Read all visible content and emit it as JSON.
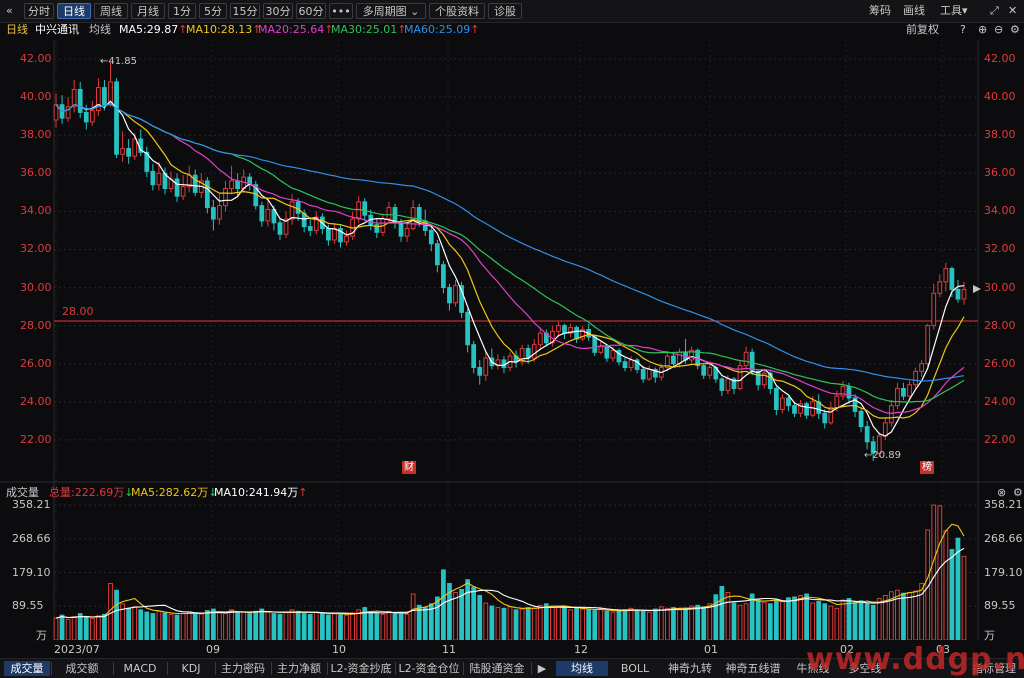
{
  "toolbar": {
    "back": "«",
    "buttons": [
      "分时",
      "日线",
      "周线",
      "月线",
      "1分",
      "5分",
      "15分",
      "30分",
      "60分",
      "•••",
      "多周期图 ⌄",
      "个股资料",
      "诊股"
    ],
    "active": "日线",
    "right": [
      "筹码",
      "画线",
      "工具▾"
    ]
  },
  "info": {
    "period": "日线",
    "stock": "中兴通讯",
    "ma_label": "均线",
    "ma5": "MA5:29.87",
    "ma10": "MA10:28.13",
    "ma20": "MA20:25.64",
    "ma30": "MA30:25.01",
    "ma60": "MA60:25.09",
    "adjust": "前复权"
  },
  "colors": {
    "up": "#e03a3a",
    "down": "#27c2c2",
    "ma5": "#ffffff",
    "ma10": "#f0c419",
    "ma20": "#e040c8",
    "ma30": "#2fc25b",
    "ma60": "#2f8fe8",
    "ref_line": "#e03a3a"
  },
  "price_axis": [
    "42.00",
    "40.00",
    "38.00",
    "36.00",
    "34.00",
    "32.00",
    "30.00",
    "28.00",
    "26.00",
    "24.00",
    "22.00"
  ],
  "ref_line_label": "28.00",
  "annotations": {
    "high": "←41.85",
    "low": "←20.89",
    "marker1": "财",
    "marker2": "榜"
  },
  "volume": {
    "title": "成交量",
    "total": "总量:222.69万",
    "ma5": "MA5:282.62万",
    "ma10": "MA10:241.94万",
    "axis": [
      "358.21",
      "268.66",
      "179.10",
      "89.55",
      "万"
    ]
  },
  "x_labels": [
    "2023/07",
    "09",
    "10",
    "11",
    "12",
    "01",
    "02",
    "03"
  ],
  "bottom_tabs_left": [
    "成交量",
    "成交额",
    "MACD",
    "KDJ",
    "主力密码",
    "主力净额",
    "L2-资金抄底",
    "L2-资金仓位",
    "陆股通资金"
  ],
  "bottom_tabs_right": [
    "均线",
    "BOLL",
    "神奇九转",
    "神奇五线谱",
    "牛熊线",
    "多空线"
  ],
  "bottom_right": "指标管理",
  "watermark": "www.ddgp.net",
  "chart_data": {
    "type": "candlestick",
    "symbol": "中兴通讯",
    "period": "日线",
    "ylim": [
      20,
      43
    ],
    "x_range": [
      "2023/07",
      "2024/03"
    ],
    "volume_ylim": [
      0,
      358.21
    ],
    "volume_unit": "万",
    "candles": [
      [
        38.8,
        39.6,
        40.2,
        38.4
      ],
      [
        39.6,
        38.9,
        40.1,
        38.6
      ],
      [
        38.9,
        39.5,
        40.0,
        38.7
      ],
      [
        39.5,
        40.4,
        40.9,
        39.2
      ],
      [
        40.4,
        39.2,
        40.8,
        38.9
      ],
      [
        39.2,
        38.7,
        39.6,
        38.3
      ],
      [
        38.7,
        39.3,
        39.8,
        38.5
      ],
      [
        39.3,
        40.5,
        41.0,
        39.0
      ],
      [
        40.5,
        39.6,
        40.9,
        39.3
      ],
      [
        39.6,
        40.8,
        41.85,
        39.5
      ],
      [
        40.8,
        37.0,
        41.0,
        36.8
      ],
      [
        37.0,
        37.3,
        38.2,
        36.6
      ],
      [
        37.3,
        36.9,
        37.8,
        36.5
      ],
      [
        36.9,
        37.8,
        38.1,
        36.7
      ],
      [
        37.8,
        37.1,
        38.3,
        36.9
      ],
      [
        37.1,
        36.1,
        37.4,
        35.8
      ],
      [
        36.1,
        35.4,
        36.5,
        35.1
      ],
      [
        35.4,
        36.0,
        36.6,
        35.1
      ],
      [
        36.0,
        35.2,
        36.3,
        34.9
      ],
      [
        35.2,
        35.7,
        36.1,
        35.0
      ],
      [
        35.7,
        34.8,
        36.0,
        34.5
      ],
      [
        34.8,
        35.3,
        35.9,
        34.6
      ],
      [
        35.3,
        35.9,
        36.4,
        35.0
      ],
      [
        35.9,
        35.0,
        36.2,
        34.8
      ],
      [
        35.0,
        35.6,
        36.0,
        34.7
      ],
      [
        35.6,
        34.2,
        35.8,
        33.9
      ],
      [
        34.2,
        33.6,
        34.6,
        33.0
      ],
      [
        33.6,
        34.3,
        34.9,
        33.3
      ],
      [
        34.3,
        35.2,
        35.6,
        34.0
      ],
      [
        35.2,
        35.6,
        36.4,
        34.9
      ],
      [
        35.6,
        35.2,
        36.0,
        34.8
      ],
      [
        35.2,
        35.8,
        36.2,
        35.0
      ],
      [
        35.8,
        35.4,
        36.0,
        35.1
      ],
      [
        35.4,
        34.3,
        35.6,
        34.1
      ],
      [
        34.3,
        33.5,
        34.5,
        33.2
      ],
      [
        33.5,
        34.1,
        34.6,
        33.2
      ],
      [
        34.1,
        33.4,
        34.3,
        33.0
      ],
      [
        33.4,
        32.8,
        33.6,
        32.5
      ],
      [
        32.8,
        33.6,
        34.0,
        32.6
      ],
      [
        33.6,
        34.5,
        34.9,
        33.3
      ],
      [
        34.5,
        33.9,
        34.7,
        33.5
      ],
      [
        33.9,
        33.2,
        34.1,
        32.9
      ],
      [
        33.2,
        33.0,
        33.6,
        32.7
      ],
      [
        33.0,
        33.7,
        34.0,
        32.8
      ],
      [
        33.7,
        33.1,
        33.9,
        32.8
      ],
      [
        33.1,
        32.5,
        33.3,
        32.2
      ],
      [
        32.5,
        33.1,
        33.4,
        32.3
      ],
      [
        33.1,
        32.4,
        33.3,
        32.1
      ],
      [
        32.4,
        32.7,
        33.0,
        32.2
      ],
      [
        32.7,
        33.6,
        34.0,
        32.5
      ],
      [
        33.6,
        34.5,
        34.8,
        33.4
      ],
      [
        34.5,
        33.8,
        34.7,
        33.5
      ],
      [
        33.8,
        33.3,
        34.1,
        33.0
      ],
      [
        33.3,
        32.9,
        33.6,
        32.6
      ],
      [
        32.9,
        33.6,
        33.9,
        32.7
      ],
      [
        33.6,
        34.2,
        34.5,
        33.4
      ],
      [
        34.2,
        33.4,
        34.4,
        33.1
      ],
      [
        33.4,
        32.7,
        33.6,
        32.4
      ],
      [
        32.7,
        33.1,
        33.4,
        32.4
      ],
      [
        33.1,
        34.2,
        34.6,
        33.0
      ],
      [
        34.2,
        33.5,
        34.4,
        33.2
      ],
      [
        33.5,
        33.0,
        34.1,
        32.7
      ],
      [
        33.0,
        32.3,
        33.2,
        31.9
      ],
      [
        32.3,
        31.2,
        32.5,
        30.8
      ],
      [
        31.2,
        30.0,
        31.4,
        29.7
      ],
      [
        30.0,
        29.2,
        30.2,
        28.8
      ],
      [
        29.2,
        30.1,
        30.4,
        29.0
      ],
      [
        30.1,
        28.7,
        30.3,
        28.4
      ],
      [
        28.7,
        27.0,
        28.9,
        26.6
      ],
      [
        27.0,
        25.8,
        27.2,
        25.5
      ],
      [
        25.8,
        25.4,
        26.2,
        24.9
      ],
      [
        25.4,
        26.3,
        26.6,
        25.1
      ],
      [
        26.3,
        25.9,
        26.8,
        25.7
      ],
      [
        25.9,
        26.2,
        26.5,
        25.7
      ],
      [
        26.2,
        25.8,
        26.4,
        25.5
      ],
      [
        25.8,
        26.4,
        26.6,
        25.6
      ],
      [
        26.4,
        26.1,
        26.7,
        25.8
      ],
      [
        26.1,
        26.8,
        27.0,
        25.9
      ],
      [
        26.8,
        26.3,
        27.0,
        26.0
      ],
      [
        26.3,
        27.0,
        27.3,
        26.1
      ],
      [
        27.0,
        27.6,
        27.9,
        26.8
      ],
      [
        27.6,
        27.1,
        27.8,
        26.9
      ],
      [
        27.1,
        27.7,
        28.0,
        26.9
      ],
      [
        27.7,
        28.0,
        28.2,
        27.4
      ],
      [
        28.0,
        27.6,
        28.1,
        27.3
      ],
      [
        27.6,
        27.9,
        28.1,
        27.4
      ],
      [
        27.9,
        27.3,
        28.0,
        27.1
      ],
      [
        27.3,
        27.8,
        28.0,
        27.2
      ],
      [
        27.8,
        27.4,
        28.1,
        27.2
      ],
      [
        27.4,
        26.6,
        27.5,
        26.4
      ],
      [
        26.6,
        26.9,
        27.2,
        26.5
      ],
      [
        26.9,
        26.3,
        27.0,
        26.1
      ],
      [
        26.3,
        26.7,
        26.9,
        26.1
      ],
      [
        26.7,
        26.1,
        26.8,
        25.9
      ],
      [
        26.1,
        25.8,
        26.3,
        25.6
      ],
      [
        25.8,
        26.2,
        26.4,
        25.6
      ],
      [
        26.2,
        25.7,
        26.3,
        25.5
      ],
      [
        25.7,
        25.2,
        25.9,
        25.0
      ],
      [
        25.2,
        25.7,
        25.9,
        25.1
      ],
      [
        25.7,
        25.3,
        25.8,
        25.0
      ],
      [
        25.3,
        25.8,
        26.0,
        25.1
      ],
      [
        25.8,
        26.4,
        26.6,
        25.6
      ],
      [
        26.4,
        26.0,
        26.6,
        25.8
      ],
      [
        26.0,
        26.6,
        26.8,
        25.8
      ],
      [
        26.6,
        26.2,
        27.3,
        26.0
      ],
      [
        26.2,
        26.7,
        26.9,
        26.0
      ],
      [
        26.7,
        25.9,
        26.8,
        25.7
      ],
      [
        25.9,
        25.4,
        26.0,
        25.2
      ],
      [
        25.4,
        25.8,
        26.0,
        25.2
      ],
      [
        25.8,
        25.2,
        25.9,
        25.0
      ],
      [
        25.2,
        24.6,
        25.3,
        24.3
      ],
      [
        24.6,
        25.2,
        25.4,
        24.4
      ],
      [
        25.2,
        24.7,
        25.3,
        24.4
      ],
      [
        24.7,
        25.9,
        26.2,
        24.6
      ],
      [
        25.9,
        26.6,
        26.9,
        25.7
      ],
      [
        26.6,
        25.6,
        26.8,
        25.4
      ],
      [
        25.6,
        24.9,
        25.7,
        24.6
      ],
      [
        24.9,
        25.5,
        25.7,
        24.7
      ],
      [
        25.5,
        24.7,
        25.6,
        24.4
      ],
      [
        24.7,
        23.6,
        24.8,
        23.3
      ],
      [
        23.6,
        24.2,
        24.4,
        23.4
      ],
      [
        24.2,
        23.8,
        24.3,
        23.5
      ],
      [
        23.8,
        23.4,
        24.0,
        23.2
      ],
      [
        23.4,
        23.9,
        24.1,
        23.2
      ],
      [
        23.9,
        23.3,
        24.0,
        23.1
      ],
      [
        23.3,
        24.0,
        24.3,
        23.2
      ],
      [
        24.0,
        23.4,
        24.4,
        23.1
      ],
      [
        23.4,
        22.9,
        23.6,
        22.6
      ],
      [
        22.9,
        23.7,
        24.0,
        22.8
      ],
      [
        23.7,
        24.3,
        24.6,
        23.5
      ],
      [
        24.3,
        24.8,
        25.1,
        24.1
      ],
      [
        24.8,
        24.2,
        25.0,
        23.9
      ],
      [
        24.2,
        23.5,
        24.4,
        23.2
      ],
      [
        23.5,
        22.7,
        23.7,
        22.4
      ],
      [
        22.7,
        21.9,
        23.0,
        21.5
      ],
      [
        21.9,
        21.3,
        22.2,
        20.89
      ],
      [
        21.3,
        22.2,
        22.4,
        21.1
      ],
      [
        22.2,
        22.9,
        23.2,
        22.0
      ],
      [
        22.9,
        23.8,
        24.1,
        22.7
      ],
      [
        23.8,
        24.7,
        25.0,
        23.6
      ],
      [
        24.7,
        24.3,
        25.0,
        24.1
      ],
      [
        24.3,
        24.9,
        25.1,
        24.1
      ],
      [
        24.9,
        25.6,
        25.8,
        24.7
      ],
      [
        25.6,
        26.0,
        26.2,
        25.3
      ],
      [
        26.0,
        28.0,
        28.1,
        25.8
      ],
      [
        28.0,
        29.7,
        30.2,
        27.8
      ],
      [
        29.7,
        30.3,
        30.7,
        29.5
      ],
      [
        30.3,
        31.0,
        31.3,
        29.8
      ],
      [
        31.0,
        29.9,
        31.1,
        29.5
      ],
      [
        29.9,
        29.4,
        30.4,
        29.2
      ],
      [
        29.4,
        29.9,
        30.3,
        29.1
      ]
    ],
    "volumes": [
      58,
      66,
      55,
      62,
      70,
      60,
      57,
      64,
      68,
      150,
      132,
      96,
      84,
      88,
      80,
      74,
      70,
      76,
      72,
      68,
      66,
      70,
      75,
      72,
      69,
      78,
      82,
      74,
      70,
      80,
      72,
      74,
      70,
      76,
      82,
      74,
      70,
      68,
      73,
      80,
      76,
      70,
      68,
      74,
      72,
      66,
      70,
      68,
      66,
      72,
      80,
      86,
      74,
      70,
      68,
      76,
      72,
      70,
      68,
      122,
      92,
      86,
      96,
      114,
      186,
      150,
      126,
      134,
      160,
      140,
      118,
      98,
      90,
      86,
      84,
      88,
      80,
      82,
      86,
      84,
      92,
      96,
      90,
      88,
      86,
      80,
      84,
      82,
      80,
      78,
      82,
      76,
      74,
      78,
      80,
      84,
      80,
      76,
      74,
      82,
      88,
      84,
      86,
      80,
      84,
      90,
      92,
      88,
      96,
      120,
      142,
      126,
      98,
      92,
      96,
      122,
      108,
      100,
      96,
      104,
      102,
      112,
      114,
      118,
      122,
      98,
      102,
      96,
      90,
      84,
      106,
      110,
      100,
      104,
      96,
      92,
      110,
      118,
      128,
      132,
      124,
      126,
      130,
      150,
      292,
      358,
      356,
      290,
      240,
      270,
      222
    ],
    "ma_last": {
      "MA5": 29.87,
      "MA10": 28.13,
      "MA20": 25.64,
      "MA30": 25.01,
      "MA60": 25.09
    },
    "reference_line": 28.0,
    "high": 41.85,
    "low": 20.89,
    "volume_last": {
      "total": 222.69,
      "MA5": 282.62,
      "MA10": 241.94
    }
  }
}
